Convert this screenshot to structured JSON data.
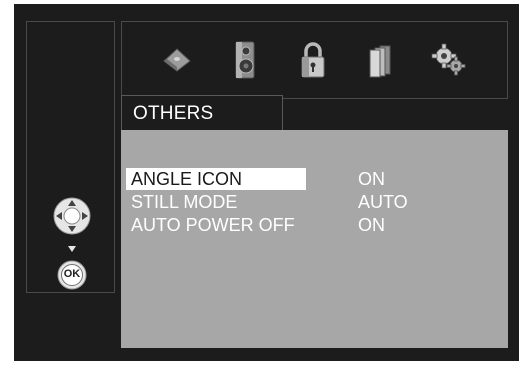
{
  "tab": {
    "label": "OTHERS"
  },
  "top_icons": [
    "disc-icon",
    "speaker-icon",
    "lock-icon",
    "books-icon",
    "gear-icon"
  ],
  "menu": {
    "selected_index": 0,
    "items": [
      {
        "label": "ANGLE ICON",
        "value": "ON"
      },
      {
        "label": "STILL MODE",
        "value": "AUTO"
      },
      {
        "label": "AUTO POWER OFF",
        "value": "ON"
      }
    ]
  },
  "controls": {
    "ok_label": "OK"
  },
  "colors": {
    "background": "#1c1c1c",
    "panel": "#a7a7a7",
    "highlight": "#ffffff"
  }
}
